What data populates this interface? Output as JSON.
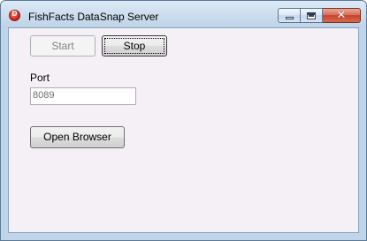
{
  "window": {
    "title": "FishFacts DataSnap Server",
    "caption": {
      "minimize_icon": "minimize-icon",
      "maximize_icon": "maximize-icon",
      "close_glyph": "✕"
    }
  },
  "controls": {
    "start_label": "Start",
    "stop_label": "Stop",
    "port_label": "Port",
    "port_value": "8089",
    "open_browser_label": "Open Browser"
  },
  "colors": {
    "client_bg": "#f5f0f5",
    "frame": "#c0d5ea",
    "close_button": "#c7432a"
  }
}
